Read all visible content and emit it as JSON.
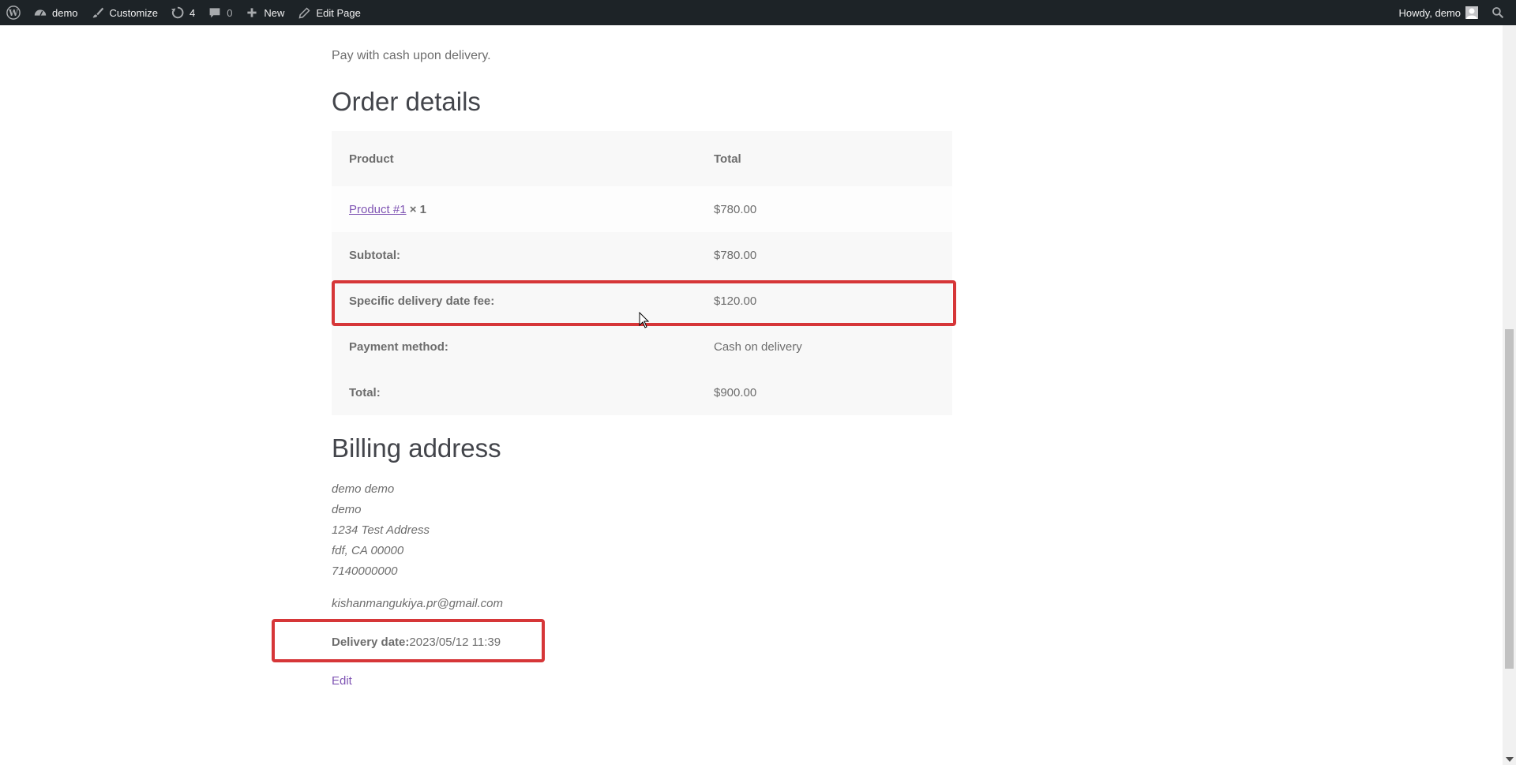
{
  "adminbar": {
    "site_name": "demo",
    "customize": "Customize",
    "updates_count": "4",
    "comments_count": "0",
    "new_label": "New",
    "edit_page": "Edit Page",
    "greeting": "Howdy, demo"
  },
  "payment_note": "Pay with cash upon delivery.",
  "order": {
    "heading": "Order details",
    "col_product": "Product",
    "col_total": "Total",
    "item": {
      "name": "Product #1",
      "qty": "× 1",
      "total": "$780.00"
    },
    "subtotal_label": "Subtotal:",
    "subtotal_value": "$780.00",
    "fee_label": "Specific delivery date fee:",
    "fee_value": "$120.00",
    "payment_label": "Payment method:",
    "payment_value": "Cash on delivery",
    "total_label": "Total:",
    "total_value": "$900.00"
  },
  "billing": {
    "heading": "Billing address",
    "lines": [
      "demo demo",
      "demo",
      "1234 Test Address",
      "fdf, CA 00000",
      "7140000000"
    ],
    "email": "kishanmangukiya.pr@gmail.com",
    "delivery_label": "Delivery date:",
    "delivery_value": "2023/05/12 11:39",
    "edit": "Edit"
  },
  "colors": {
    "highlight": "#d63638",
    "link": "#7f54b3",
    "adminbar": "#1d2327"
  }
}
